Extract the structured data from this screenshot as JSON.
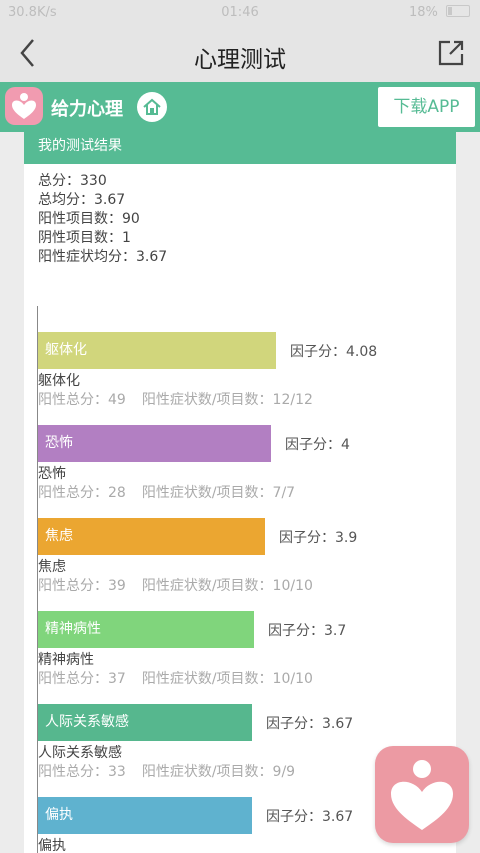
{
  "status_bar": {
    "network": "30.8K/s",
    "time": "01:46",
    "battery": "18%"
  },
  "header": {
    "title": "心理测试"
  },
  "banner": {
    "brand": "给力心理",
    "download_label": "下载APP"
  },
  "result_card": {
    "title": "我的测试结果",
    "summary": [
      "总分：330",
      "总均分：3.67",
      "阳性项目数：90",
      "阴性项目数：1",
      "阳性症状均分：3.67"
    ]
  },
  "chart_data": {
    "type": "bar",
    "orientation": "horizontal",
    "score_label": "因子分：",
    "detail_positive_total_label": "阳性总分：",
    "detail_count_label": "阳性症状数/项目数：",
    "factors": [
      {
        "name": "躯体化",
        "score": 4.08,
        "score_text": "4.08",
        "positive_total": 49,
        "counts": "12/12",
        "color": "#d1d67c"
      },
      {
        "name": "恐怖",
        "score": 4,
        "score_text": "4",
        "positive_total": 28,
        "counts": "7/7",
        "color": "#b27fc2"
      },
      {
        "name": "焦虑",
        "score": 3.9,
        "score_text": "3.9",
        "positive_total": 39,
        "counts": "10/10",
        "color": "#eba631"
      },
      {
        "name": "精神病性",
        "score": 3.7,
        "score_text": "3.7",
        "positive_total": 37,
        "counts": "10/10",
        "color": "#80d57c"
      },
      {
        "name": "人际关系敏感",
        "score": 3.67,
        "score_text": "3.67",
        "positive_total": 33,
        "counts": "9/9",
        "color": "#56b78e"
      },
      {
        "name": "偏执",
        "score": 3.67,
        "score_text": "3.67",
        "positive_total": null,
        "counts": null,
        "color": "#5fb2cf"
      }
    ]
  }
}
